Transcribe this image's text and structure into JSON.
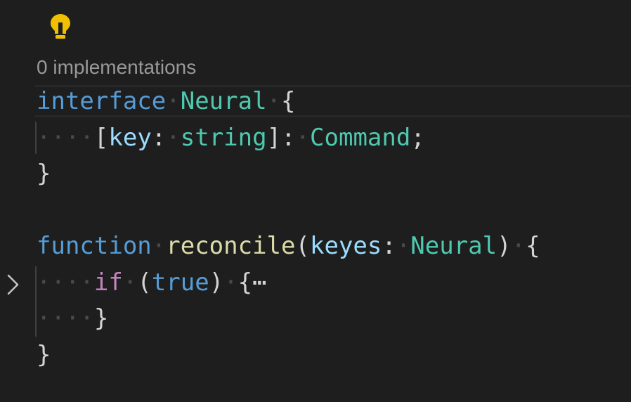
{
  "editor": {
    "codelens": "0 implementations",
    "lines": {
      "l1": {
        "kw": "interface",
        "type": "Neural",
        "brace": "{"
      },
      "l2": {
        "open_bracket": "[",
        "param": "key",
        "colon": ":",
        "ptype": "string",
        "close": "]:",
        "rtype": "Command",
        "semi": ";"
      },
      "l3": {
        "brace": "}"
      },
      "l5": {
        "kw": "function",
        "fn": "reconcile",
        "paren_open": "(",
        "param": "keyes",
        "colon": ":",
        "ptype": "Neural",
        "paren_close": ")",
        "brace": "{"
      },
      "l6": {
        "kw": "if",
        "paren_open": "(",
        "val": "true",
        "paren_close": ")",
        "brace": "{",
        "ellipsis": "⋯"
      },
      "l7": {
        "brace": "}"
      },
      "l8": {
        "brace": "}"
      }
    },
    "icons": {
      "lightbulb": "lightbulb-icon",
      "fold": "chevron-right-icon"
    },
    "colors": {
      "background": "#1e1e1e",
      "keyword": "#569cd6",
      "control": "#c586c0",
      "type": "#4ec9b0",
      "function": "#dcdcaa",
      "variable": "#9cdcfe",
      "punctuation": "#d4d4d4",
      "whitespace": "#4a4a4a",
      "lightbulb": "#f0c000"
    }
  }
}
